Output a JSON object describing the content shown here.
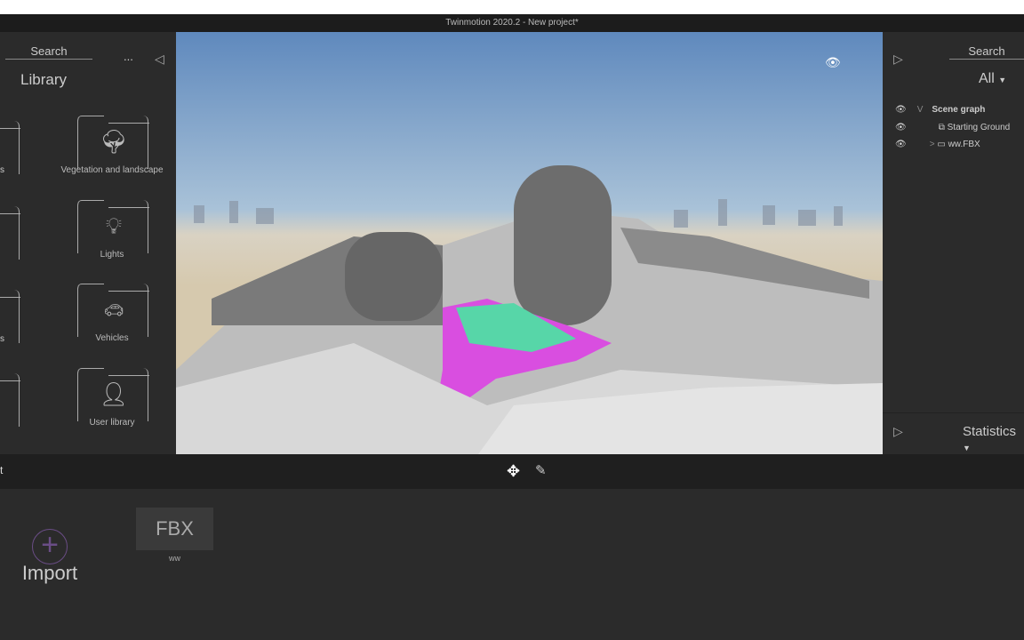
{
  "window": {
    "title": "Twinmotion 2020.2 - New project*"
  },
  "library": {
    "search_label": "Search",
    "more": "...",
    "title": "Library",
    "categories": [
      {
        "label": "Vegetation and landscape",
        "icon": "tree-icon"
      },
      {
        "label": "Lights",
        "icon": "lightbulb-icon"
      },
      {
        "label": "Vehicles",
        "icon": "car-icon"
      },
      {
        "label": "User library",
        "icon": "user-icon"
      }
    ],
    "partial_labels": [
      "s",
      "s"
    ]
  },
  "scene": {
    "search_label": "Search",
    "filter": "All",
    "tree": [
      {
        "label": "Scene graph",
        "expander": "V"
      },
      {
        "label": "Starting Ground"
      },
      {
        "label": "ww.FBX",
        "expander": ">"
      }
    ],
    "statistics": "Statistics"
  },
  "toolbar": {
    "left_text": "t"
  },
  "import": {
    "label": "Import",
    "file_type": "FBX",
    "file_name": "ww"
  }
}
